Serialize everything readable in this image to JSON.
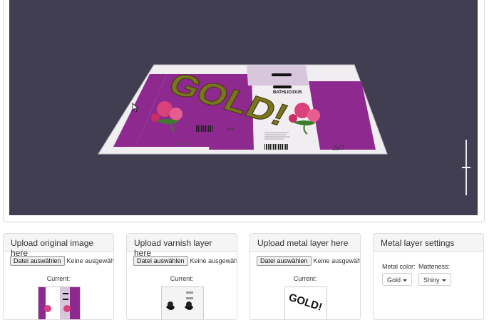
{
  "viewer": {
    "overlay_text": "GOLD!",
    "box_brand": "BATHLICIOUS",
    "box_script_text": "sakura salt",
    "box_weight": "400g"
  },
  "panels": [
    {
      "title": "Upload original image here",
      "choose_label": "Datei auswählen",
      "no_file_label": "Keine ausgewählt",
      "current_label": "Current:"
    },
    {
      "title": "Upload varnish layer here",
      "choose_label": "Datei auswählen",
      "no_file_label": "Keine ausgewählt",
      "current_label": "Current:"
    },
    {
      "title": "Upload metal layer here",
      "choose_label": "Datei auswählen",
      "no_file_label": "Keine ausgewählt",
      "current_label": "Current:",
      "thumb_text": "GOLD!"
    }
  ],
  "settings": {
    "title": "Metal layer settings",
    "color_label": "Metal color:",
    "matteness_label": "Matteness:",
    "color_value": "Gold",
    "matteness_value": "Shiny"
  },
  "colors": {
    "viewer_bg": "#413e51",
    "purple": "#8e2a8f",
    "gold": "#7a7420",
    "lilac": "#d7c6dc"
  },
  "icons": {
    "cursor": "arrow-cursor-icon",
    "slider": "zoom-slider"
  }
}
